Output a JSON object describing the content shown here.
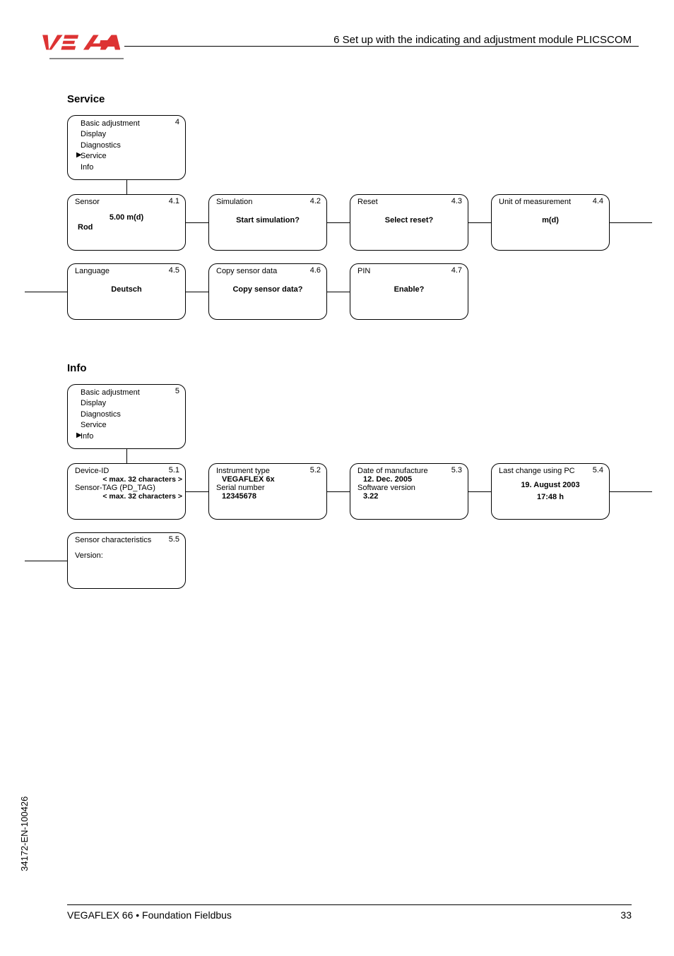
{
  "header": {
    "chapter": "6   Set up with the indicating and adjustment module PLICSCOM"
  },
  "sections": {
    "service": "Service",
    "info": "Info"
  },
  "menu": {
    "basic": "Basic adjustment",
    "display": "Display",
    "diag": "Diagnostics",
    "service": "Service",
    "info": "Info"
  },
  "service": {
    "menuNum": "4",
    "s41": {
      "num": "4.1",
      "title": "Sensor",
      "val1": "5.00 m(d)",
      "val2": "Rod"
    },
    "s42": {
      "num": "4.2",
      "title": "Simulation",
      "val": "Start simulation?"
    },
    "s43": {
      "num": "4.3",
      "title": "Reset",
      "val": "Select reset?"
    },
    "s44": {
      "num": "4.4",
      "title": "Unit of measurement",
      "val": "m(d)"
    },
    "s45": {
      "num": "4.5",
      "title": "Language",
      "val": "Deutsch"
    },
    "s46": {
      "num": "4.6",
      "title": "Copy sensor data",
      "val": "Copy sensor data?"
    },
    "s47": {
      "num": "4.7",
      "title": "PIN",
      "val": "Enable?"
    }
  },
  "info": {
    "menuNum": "5",
    "s51": {
      "num": "5.1",
      "l1": "Device-ID",
      "v1": "< max. 32 characters >",
      "l2": "Sensor-TAG (PD_TAG)",
      "v2": "< max. 32 characters >"
    },
    "s52": {
      "num": "5.2",
      "l1": "Instrument type",
      "v1": "VEGAFLEX 6x",
      "l2": "Serial number",
      "v2": "12345678"
    },
    "s53": {
      "num": "5.3",
      "l1": "Date of manufacture",
      "v1": "12. Dec. 2005",
      "l2": "Software version",
      "v2": "3.22"
    },
    "s54": {
      "num": "5.4",
      "l1": "Last change using PC",
      "v1": "19. August 2003",
      "v2": "17:48 h"
    },
    "s55": {
      "num": "5.5",
      "l1": "Sensor characteristics",
      "l2": "Version:"
    }
  },
  "footer": {
    "doc": "VEGAFLEX 66 • Foundation Fieldbus",
    "page": "33",
    "side": "34172-EN-100426"
  }
}
